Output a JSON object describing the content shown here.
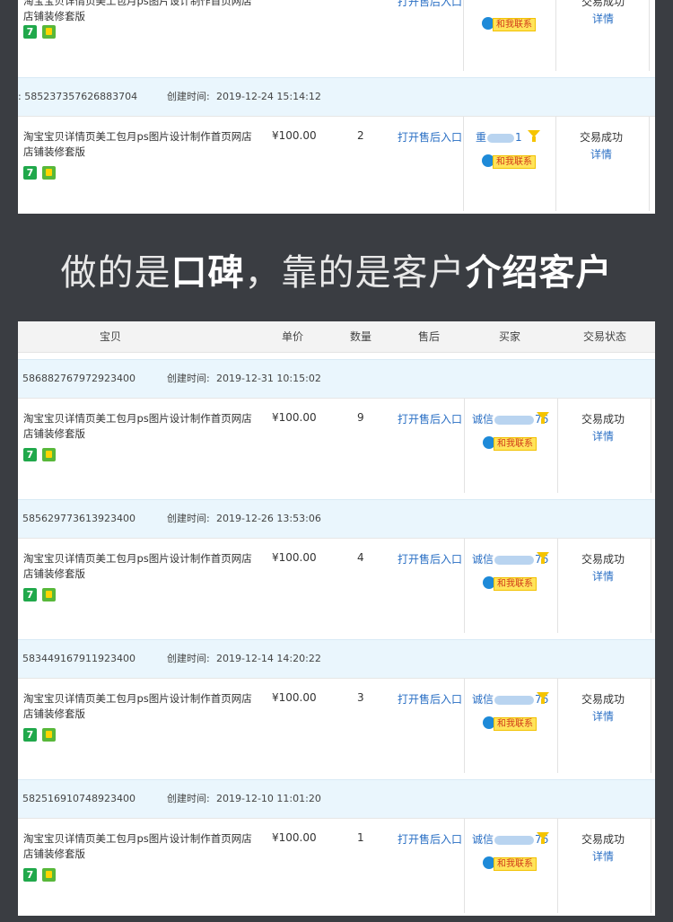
{
  "top": {
    "partial_order": {
      "title": "淘宝宝贝详情页美工包月ps图片设计制作首页网店店铺装修套版",
      "after_sale": "打开售后入口",
      "contact": "和我联系",
      "status": "交易成功",
      "detail": "详情"
    },
    "order": {
      "order_no": ": 585237357626883704",
      "created_label": "创建时间:",
      "created_at": "2019-12-24 15:14:12",
      "title": "淘宝宝贝详情页美工包月ps图片设计制作首页网店店铺装修套版",
      "price": "¥100.00",
      "qty": "2",
      "after_sale": "打开售后入口",
      "buyer_prefix": "重",
      "buyer_suffix": "1",
      "contact": "和我联系",
      "status": "交易成功",
      "detail": "详情"
    }
  },
  "heading": {
    "part1": "做的是",
    "part2": "口碑",
    "part3": "，靠的是客户",
    "part4": "介绍客户"
  },
  "table_header": {
    "item": "宝贝",
    "price": "单价",
    "qty": "数量",
    "after": "售后",
    "buyer": "买家",
    "status": "交易状态"
  },
  "orders": [
    {
      "order_no": "586882767972923400",
      "created_label": "创建时间:",
      "created_at": "2019-12-31 10:15:02",
      "title": "淘宝宝贝详情页美工包月ps图片设计制作首页网店店铺装修套版",
      "price": "¥100.00",
      "qty": "9",
      "after_sale": "打开售后入口",
      "buyer_prefix": "诚信",
      "buyer_suffix": "76",
      "contact": "和我联系",
      "status": "交易成功",
      "detail": "详情"
    },
    {
      "order_no": "585629773613923400",
      "created_label": "创建时间:",
      "created_at": "2019-12-26 13:53:06",
      "title": "淘宝宝贝详情页美工包月ps图片设计制作首页网店店铺装修套版",
      "price": "¥100.00",
      "qty": "4",
      "after_sale": "打开售后入口",
      "buyer_prefix": "诚信",
      "buyer_suffix": "76",
      "contact": "和我联系",
      "status": "交易成功",
      "detail": "详情"
    },
    {
      "order_no": "583449167911923400",
      "created_label": "创建时间:",
      "created_at": "2019-12-14 14:20:22",
      "title": "淘宝宝贝详情页美工包月ps图片设计制作首页网店店铺装修套版",
      "price": "¥100.00",
      "qty": "3",
      "after_sale": "打开售后入口",
      "buyer_prefix": "诚信",
      "buyer_suffix": "76",
      "contact": "和我联系",
      "status": "交易成功",
      "detail": "详情"
    },
    {
      "order_no": "582516910748923400",
      "created_label": "创建时间:",
      "created_at": "2019-12-10 11:01:20",
      "title": "淘宝宝贝详情页美工包月ps图片设计制作首页网店店铺装修套版",
      "price": "¥100.00",
      "qty": "1",
      "after_sale": "打开售后入口",
      "buyer_prefix": "诚信",
      "buyer_suffix": "76",
      "contact": "和我联系",
      "status": "交易成功",
      "detail": "详情"
    }
  ],
  "colors": {
    "background": "#3a3d42",
    "link": "#2a6fc4",
    "order_header": "#eaf6fd",
    "badge_green": "#20a84b",
    "filter_yellow": "#f5c400"
  },
  "icons": [
    "seven-day-return-icon",
    "shopping-bag-icon",
    "filter-icon",
    "chat-contact-icon"
  ]
}
